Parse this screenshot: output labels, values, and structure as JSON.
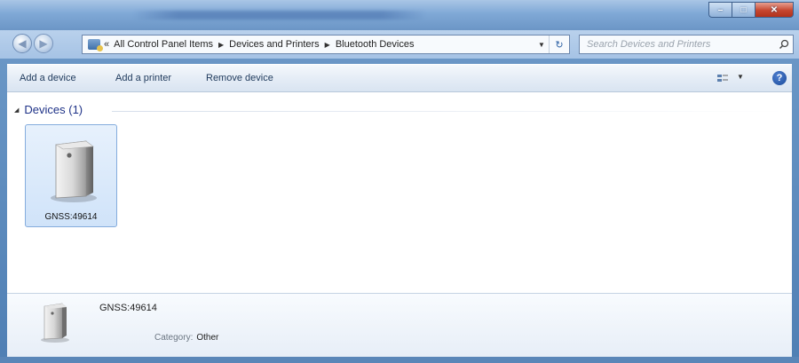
{
  "address_bar": {
    "overflow": "«",
    "crumbs": [
      "All Control Panel Items",
      "Devices and Printers",
      "Bluetooth Devices"
    ]
  },
  "search": {
    "placeholder": "Search Devices and Printers"
  },
  "toolbar": {
    "add_device": "Add a device",
    "add_printer": "Add a printer",
    "remove_device": "Remove device",
    "help": "?"
  },
  "group": {
    "label": "Devices (1)"
  },
  "devices": [
    {
      "name": "GNSS:49614",
      "icon": "generic-device-icon"
    }
  ],
  "details": {
    "name": "GNSS:49614",
    "category_label": "Category:",
    "category_value": "Other"
  },
  "colors": {
    "frame": "#6f9bc9",
    "selection_fill": "#d0e3f9",
    "selection_border": "#84acdd",
    "group_header": "#1e3287",
    "close_button": "#c6462f"
  }
}
